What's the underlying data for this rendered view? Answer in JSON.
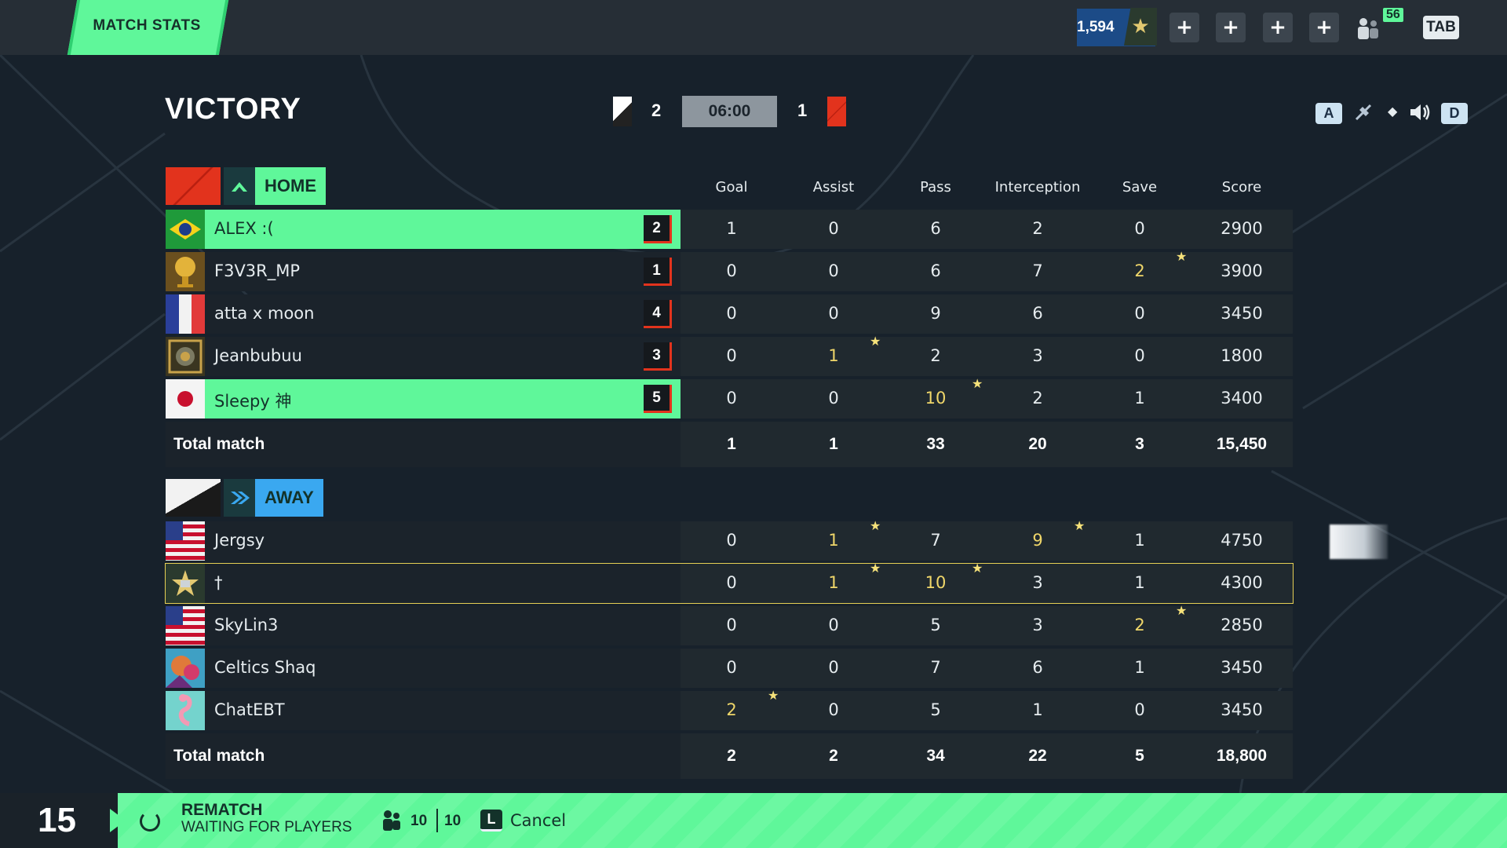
{
  "topbar": {
    "title": "MATCH STATS",
    "currency": "1,594",
    "friends_count": "56",
    "tab_key": "TAB",
    "plus_label": "+"
  },
  "header": {
    "result": "VICTORY",
    "score_home": "2",
    "score_away": "1",
    "timer": "06:00",
    "key_left": "A",
    "key_right": "D"
  },
  "columns": [
    "Goal",
    "Assist",
    "Pass",
    "Interception",
    "Save",
    "Score"
  ],
  "home": {
    "label": "HOME",
    "players": [
      {
        "name": "ALEX :(",
        "rank": "2",
        "highlight": true,
        "flag": "brazil",
        "stats": [
          "1",
          "0",
          "6",
          "2",
          "0",
          "2900"
        ]
      },
      {
        "name": "F3V3R_MP",
        "rank": "1",
        "highlight": false,
        "flag": "trophy",
        "stats": [
          "0",
          "0",
          "6",
          "7",
          "2",
          "3900"
        ]
      },
      {
        "name": "atta x moon",
        "rank": "4",
        "highlight": false,
        "flag": "france",
        "stats": [
          "0",
          "0",
          "9",
          "6",
          "0",
          "3450"
        ]
      },
      {
        "name": "Jeanbubuu",
        "rank": "3",
        "highlight": false,
        "flag": "emblem",
        "stats": [
          "0",
          "1",
          "2",
          "3",
          "0",
          "1800"
        ]
      },
      {
        "name": "Sleepy 神",
        "rank": "5",
        "highlight": true,
        "flag": "japan",
        "stats": [
          "0",
          "0",
          "10",
          "2",
          "1",
          "3400"
        ]
      }
    ],
    "total_label": "Total match",
    "totals": [
      "1",
      "1",
      "33",
      "20",
      "3",
      "15,450"
    ]
  },
  "away": {
    "label": "AWAY",
    "players": [
      {
        "name": "Jergsy",
        "flag": "usa",
        "me": false,
        "stats": [
          "0",
          "1",
          "7",
          "9",
          "1",
          "4750"
        ]
      },
      {
        "name": "†",
        "flag": "emblem-star",
        "me": true,
        "stats": [
          "0",
          "1",
          "10",
          "3",
          "1",
          "4300"
        ]
      },
      {
        "name": "SkyLin3",
        "flag": "usa",
        "me": false,
        "stats": [
          "0",
          "0",
          "5",
          "3",
          "2",
          "2850"
        ]
      },
      {
        "name": "Celtics Shaq",
        "flag": "avatar-art",
        "me": false,
        "stats": [
          "0",
          "0",
          "7",
          "6",
          "1",
          "3450"
        ]
      },
      {
        "name": "ChatEBT",
        "flag": "flamingo",
        "me": false,
        "stats": [
          "2",
          "0",
          "5",
          "1",
          "0",
          "3450"
        ]
      }
    ],
    "total_label": "Total match",
    "totals": [
      "2",
      "2",
      "34",
      "22",
      "5",
      "18,800"
    ]
  },
  "bottom": {
    "countdown": "15",
    "rematch": "REMATCH",
    "status": "WAITING FOR PLAYERS",
    "players_ready": "10",
    "players_max": "10",
    "cancel_key": "L",
    "cancel_label": "Cancel"
  },
  "colors": {
    "accent": "#5ff79a",
    "away_accent": "#3aa8f0",
    "home_red": "#e2331d",
    "gold": "#f0d76a",
    "background": "#17212b"
  }
}
